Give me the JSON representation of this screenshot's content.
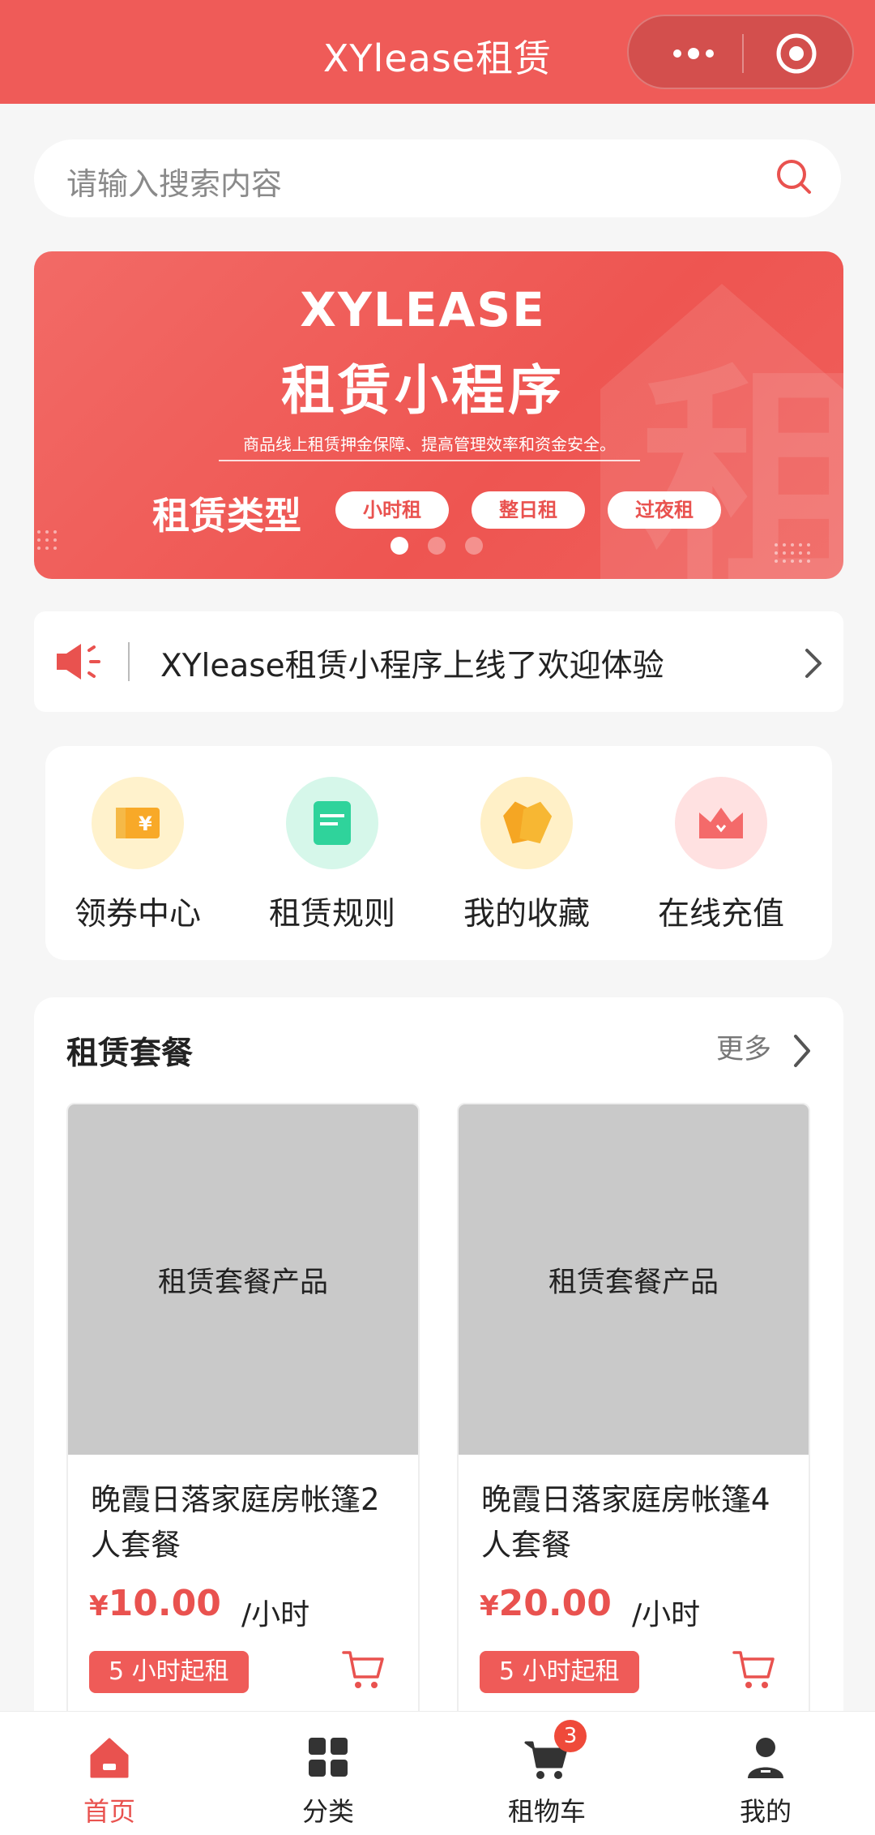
{
  "header": {
    "title": "XYlease租赁"
  },
  "search": {
    "placeholder": "请输入搜索内容"
  },
  "banner": {
    "brand": "XYLEASE",
    "headline": "租赁小程序",
    "subtitle": "商品线上租赁押金保障、提高管理效率和资金安全。",
    "types_label": "租赁类型",
    "types": [
      "小时租",
      "整日租",
      "过夜租"
    ],
    "active_slide": 1,
    "slide_count": 3
  },
  "notice": {
    "text": "XYlease租赁小程序上线了欢迎体验"
  },
  "menu": [
    {
      "label": "领券中心",
      "icon": "coupon-icon"
    },
    {
      "label": "租赁规则",
      "icon": "rules-icon"
    },
    {
      "label": "我的收藏",
      "icon": "favorites-icon"
    },
    {
      "label": "在线充值",
      "icon": "recharge-icon"
    }
  ],
  "packages": {
    "title": "租赁套餐",
    "more_label": "更多",
    "items": [
      {
        "image_text": "租赁套餐产品",
        "name": "晚霞日落家庭房帐篷2人套餐",
        "currency": "¥",
        "price": "10.00",
        "unit": "/小时",
        "tag": "5 小时起租"
      },
      {
        "image_text": "租赁套餐产品",
        "name": "晚霞日落家庭房帐篷4人套餐",
        "currency": "¥",
        "price": "20.00",
        "unit": "/小时",
        "tag": "5 小时起租"
      }
    ]
  },
  "tabbar": {
    "items": [
      {
        "label": "首页",
        "icon": "home-icon",
        "active": true
      },
      {
        "label": "分类",
        "icon": "category-icon",
        "active": false
      },
      {
        "label": "租物车",
        "icon": "cart-icon",
        "active": false,
        "badge": "3"
      },
      {
        "label": "我的",
        "icon": "profile-icon",
        "active": false
      }
    ]
  },
  "colors": {
    "primary": "#ef5b58",
    "price": "#e9524f",
    "background": "#f6f6f6"
  }
}
